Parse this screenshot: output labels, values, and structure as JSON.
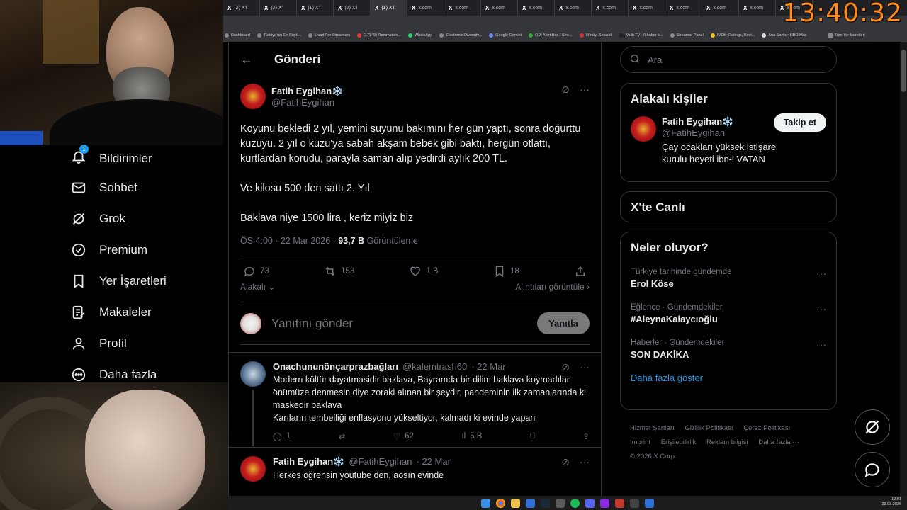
{
  "clock": "13:40:32",
  "tabs": [
    "(2) X'i",
    "(2) X'i",
    "(1) X'i",
    "(2) X'i",
    "(1) X'i",
    "x.com",
    "x.com",
    "x.com",
    "x.com",
    "x.com",
    "x.com",
    "x.com",
    "x.com",
    "x.com",
    "x.com",
    "x.com"
  ],
  "bookmarks": [
    "Dashboard",
    "Türkiye'nin En Büyü...",
    "Livad For Streamers",
    "(17145) Rammstein...",
    "WhatsApp",
    "Electronic Diversity...",
    "Google Gemini",
    "(19) Alert Box / Stre...",
    "Windy: Sıcaklık",
    "Multi TV - 6 haber k...",
    "Streamer Panel",
    "IMDb: Ratings, Revi...",
    "Ana Sayfa • HBO Max",
    "Tüm Yer İşaretleri"
  ],
  "nav": {
    "notifications": "Bildirimler",
    "notifications_badge": "1",
    "messages": "Sohbet",
    "grok": "Grok",
    "premium": "Premium",
    "bookmarks": "Yer İşaretleri",
    "articles": "Makaleler",
    "profile": "Profil",
    "more": "Daha fazla"
  },
  "header": {
    "title": "Gönderi"
  },
  "post": {
    "author": "Fatih Eygihan❄️",
    "handle": "@FatihEygihan",
    "text": "Koyunu bekledi 2 yıl, yemini suyunu bakımını her gün yaptı, sonra doğurttu kuzuyu. 2 yıl o kuzu'ya sabah akşam bebek gibi baktı, hergün otlattı, kurtlardan korudu, parayla saman alıp yedirdi aylık 200 TL.\n\nVe kilosu 500 den sattı 2. Yıl\n\nBaklava niye 1500 lira , keriz miyiz biz",
    "time": "ÖS 4:00 · 22 Mar 2026 · ",
    "views": "93,7 B",
    "views_label": " Görüntüleme",
    "replies": "73",
    "reposts": "153",
    "likes": "1 B",
    "bookmarks": "18",
    "relevant": "Alakalı",
    "quotes": "Alıntıları görüntüle"
  },
  "reply": {
    "placeholder": "Yanıtını gönder",
    "button": "Yanıtla"
  },
  "comments": [
    {
      "author": "Onachununönçarprazbağları",
      "handle": "@kalemtrash60",
      "date": "· 22 Mar",
      "text": "Modern kültür dayatmasidir baklava, Bayramda bir dilim baklava koymadılar önümüze denmesin diye zoraki alınan bir şeydir, pandeminin ilk zamanlarında ki maskedir baklava\nKarıların tembelliği enflasyonu yükseltiyor, kalmadı ki evinde yapan",
      "replies": "1",
      "likes": "62",
      "views": "5 B"
    },
    {
      "author": "Fatih Eygihan❄️",
      "handle": "@FatihEygihan",
      "date": "· 22 Mar",
      "text": "Herkes öğrensin youtube den, aösın evinde"
    }
  ],
  "right": {
    "search_placeholder": "Ara",
    "related_title": "Alakalı kişiler",
    "related_name": "Fatih Eygihan❄️",
    "related_handle": "@FatihEygihan",
    "related_bio": "Çay ocakları yüksek istişare kurulu heyeti ibn-i VATAN",
    "follow": "Takip et",
    "live_title": "X'te Canlı",
    "trends_title": "Neler oluyor?",
    "trends": [
      {
        "meta": "Türkiye tarihinde gündemde",
        "name": "Erol Köse"
      },
      {
        "meta": "Eğlence · Gündemdekiler",
        "name": "#AleynaKalaycıoğlu"
      },
      {
        "meta": "Haberler · Gündemdekiler",
        "name": "SON DAKİKA"
      }
    ],
    "show_more": "Daha fazla göster",
    "footer": [
      "Hizmet Şartları",
      "Gizlilik Politikası",
      "Çerez Politikası",
      "Imprint",
      "Erişilebilirlik",
      "Reklam bilgisi",
      "Daha fazla ···",
      "© 2026 X Corp."
    ]
  },
  "taskbar": {
    "time": "19:01",
    "date": "23.03.2026"
  },
  "colors": {
    "accent": "#1d9bf0",
    "clock": "#ff8a1a",
    "background": "#000000"
  }
}
